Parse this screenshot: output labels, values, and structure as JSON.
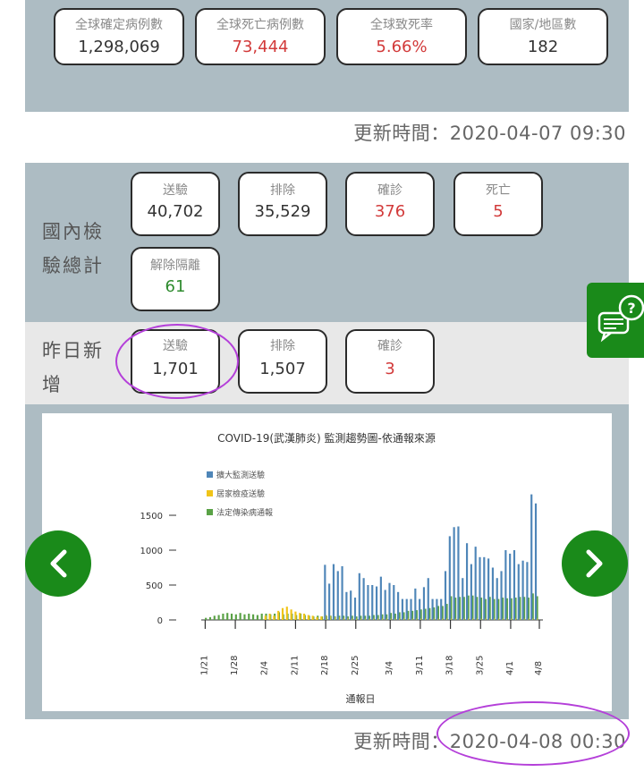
{
  "global": {
    "cards": [
      {
        "label": "全球確定病例數",
        "value": "1,298,069",
        "color": "#333333"
      },
      {
        "label": "全球死亡病例數",
        "value": "73,444",
        "color": "#d23a3a"
      },
      {
        "label": "全球致死率",
        "value": "5.66%",
        "color": "#d23a3a"
      },
      {
        "label": "國家/地區數",
        "value": "182",
        "color": "#333333"
      }
    ],
    "update_text": "更新時間：2020-04-07 09:30"
  },
  "domestic": {
    "title": "國內檢驗總計",
    "title_line1": "國內檢",
    "title_line2": "驗總計",
    "cards": [
      {
        "label": "送驗",
        "value": "40,702"
      },
      {
        "label": "排除",
        "value": "35,529"
      },
      {
        "label": "確診",
        "value": "376"
      },
      {
        "label": "死亡",
        "value": "5"
      },
      {
        "label": "解除隔離",
        "value": "61"
      }
    ]
  },
  "yesterday": {
    "title_line1": "昨日新",
    "title_line2": "增",
    "cards": [
      {
        "label": "送驗",
        "value": "1,701"
      },
      {
        "label": "排除",
        "value": "1,507"
      },
      {
        "label": "確診",
        "value": "3"
      }
    ]
  },
  "chart_update_text": "更新時間：2020-04-08 00:30",
  "colors": {
    "panel": "#adbcc3",
    "accent_green": "#1a8a1a",
    "red": "#d23a3a",
    "highlight": "#b43fd9"
  },
  "icons": {
    "prev": "chevron-left-icon",
    "next": "chevron-right-icon",
    "help": "chat-question-icon"
  },
  "chart_data": {
    "type": "bar",
    "title": "COVID-19(武漢肺炎) 監測趨勢圖-依通報來源",
    "xlabel": "通報日",
    "ylabel": "",
    "ylim": [
      0,
      1800
    ],
    "yticks": [
      0,
      500,
      1000,
      1500
    ],
    "grid": false,
    "legend_position": "top-left",
    "xtick_labels": [
      "1/21",
      "1/28",
      "2/4",
      "2/11",
      "2/18",
      "2/25",
      "3/4",
      "3/11",
      "3/18",
      "3/25",
      "4/1",
      "4/8"
    ],
    "categories": [
      "1/21",
      "1/22",
      "1/23",
      "1/24",
      "1/25",
      "1/26",
      "1/27",
      "1/28",
      "1/29",
      "1/30",
      "1/31",
      "2/1",
      "2/2",
      "2/3",
      "2/4",
      "2/5",
      "2/6",
      "2/7",
      "2/8",
      "2/9",
      "2/10",
      "2/11",
      "2/12",
      "2/13",
      "2/14",
      "2/15",
      "2/16",
      "2/17",
      "2/18",
      "2/19",
      "2/20",
      "2/21",
      "2/22",
      "2/23",
      "2/24",
      "2/25",
      "2/26",
      "2/27",
      "2/28",
      "2/29",
      "3/1",
      "3/2",
      "3/3",
      "3/4",
      "3/5",
      "3/6",
      "3/7",
      "3/8",
      "3/9",
      "3/10",
      "3/11",
      "3/12",
      "3/13",
      "3/14",
      "3/15",
      "3/16",
      "3/17",
      "3/18",
      "3/19",
      "3/20",
      "3/21",
      "3/22",
      "3/23",
      "3/24",
      "3/25",
      "3/26",
      "3/27",
      "3/28",
      "3/29",
      "3/30",
      "3/31",
      "4/1",
      "4/2",
      "4/3",
      "4/4",
      "4/5",
      "4/6",
      "4/7"
    ],
    "series": [
      {
        "name": "擴大監測送驗",
        "color": "#4f86b8",
        "values": [
          0,
          0,
          0,
          0,
          0,
          0,
          0,
          0,
          0,
          0,
          0,
          0,
          0,
          0,
          0,
          0,
          0,
          0,
          0,
          0,
          0,
          0,
          0,
          0,
          0,
          0,
          0,
          0,
          790,
          520,
          800,
          700,
          770,
          400,
          420,
          320,
          670,
          600,
          500,
          500,
          480,
          620,
          430,
          530,
          500,
          400,
          300,
          300,
          300,
          450,
          300,
          470,
          600,
          300,
          300,
          300,
          700,
          1200,
          1330,
          1340,
          600,
          1100,
          800,
          1050,
          900,
          900,
          880,
          750,
          600,
          700,
          1000,
          950,
          1000,
          800,
          850,
          830,
          1800,
          1670
        ]
      },
      {
        "name": "居家檢疫送驗",
        "color": "#f0c419",
        "values": [
          0,
          0,
          0,
          0,
          0,
          0,
          0,
          0,
          0,
          0,
          0,
          0,
          0,
          0,
          60,
          90,
          60,
          130,
          170,
          190,
          150,
          120,
          100,
          90,
          70,
          60,
          40,
          50,
          70,
          60,
          40,
          40,
          30,
          30,
          20,
          20,
          20,
          20,
          20,
          20,
          20,
          20,
          20,
          20,
          20,
          20,
          20,
          20,
          20,
          20,
          20,
          20,
          20,
          20,
          20,
          20,
          20,
          20,
          20,
          20,
          20,
          20,
          20,
          20,
          20,
          20,
          20,
          20,
          20,
          20,
          20,
          20,
          20,
          20,
          20,
          20,
          20,
          20
        ]
      },
      {
        "name": "法定傳染病通報",
        "color": "#5aa246",
        "values": [
          30,
          40,
          60,
          70,
          90,
          100,
          90,
          80,
          100,
          80,
          90,
          80,
          70,
          90,
          90,
          80,
          90,
          110,
          80,
          90,
          90,
          70,
          90,
          70,
          60,
          50,
          60,
          50,
          60,
          60,
          50,
          60,
          60,
          50,
          60,
          50,
          60,
          60,
          60,
          70,
          70,
          80,
          80,
          100,
          90,
          110,
          110,
          130,
          130,
          140,
          150,
          160,
          170,
          180,
          200,
          200,
          230,
          340,
          320,
          330,
          330,
          350,
          350,
          330,
          320,
          300,
          330,
          300,
          300,
          320,
          310,
          310,
          320,
          330,
          330,
          320,
          380,
          340
        ]
      }
    ]
  }
}
